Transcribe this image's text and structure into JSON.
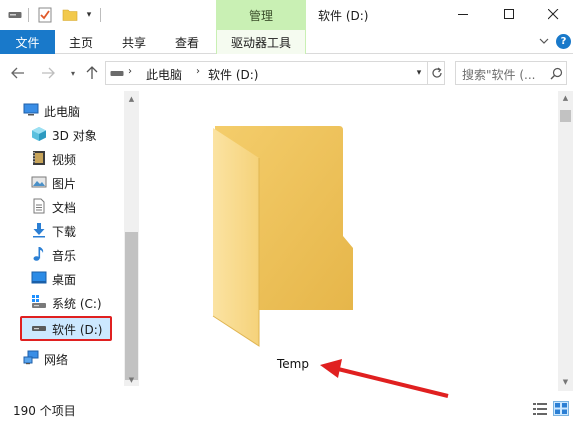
{
  "window": {
    "title": "软件 (D:)",
    "contextual_tab_group": "管理"
  },
  "ribbon": {
    "tabs": [
      "文件",
      "主页",
      "共享",
      "查看",
      "驱动器工具"
    ],
    "accent": "#1979ca",
    "contextual_color": "#c9f0b4"
  },
  "address": {
    "crumbs": [
      "此电脑",
      "软件 (D:)"
    ],
    "search_placeholder": "搜索\"软件 (..."
  },
  "nav": {
    "items": [
      {
        "label": "此电脑",
        "icon": "computer-icon"
      },
      {
        "label": "3D 对象",
        "icon": "3d-objects-icon"
      },
      {
        "label": "视频",
        "icon": "video-icon"
      },
      {
        "label": "图片",
        "icon": "pictures-icon"
      },
      {
        "label": "文档",
        "icon": "documents-icon"
      },
      {
        "label": "下载",
        "icon": "download-icon"
      },
      {
        "label": "音乐",
        "icon": "music-icon"
      },
      {
        "label": "桌面",
        "icon": "desktop-icon"
      },
      {
        "label": "系统 (C:)",
        "icon": "system-drive-icon"
      },
      {
        "label": "软件 (D:)",
        "icon": "drive-icon",
        "selected": true
      },
      {
        "label": "网络",
        "icon": "network-icon"
      }
    ]
  },
  "content": {
    "folder_name": "Temp",
    "folder_icon": "folder-icon",
    "annotation": "red-arrow-icon"
  },
  "status": {
    "item_count": "190 个项目"
  }
}
